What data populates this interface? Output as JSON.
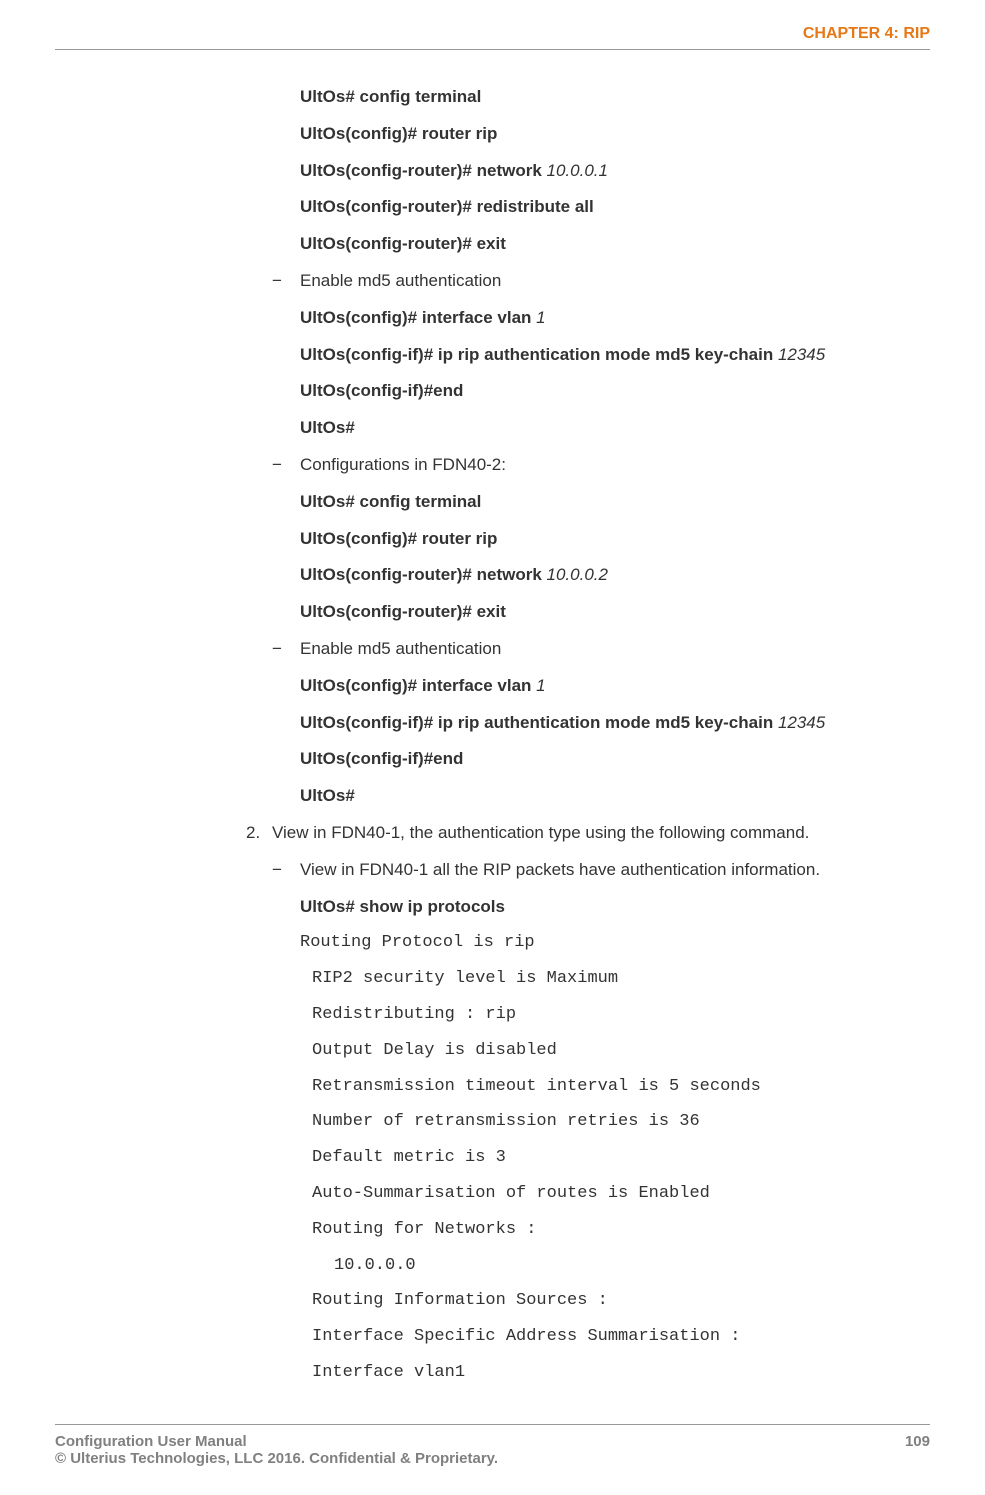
{
  "header": {
    "chapter": "CHAPTER 4: RIP"
  },
  "content": {
    "l1_cmd": "UltOs# config terminal",
    "l2_cmd": "UltOs(config)# router rip",
    "l3_cmd": "UltOs(config-router)# network ",
    "l3_arg": "10.0.0.1",
    "l4_cmd": "UltOs(config-router)# redistribute all",
    "l5_cmd": "UltOs(config-router)# exit",
    "l6_dash": "−",
    "l6_txt": "Enable md5 authentication",
    "l7_cmd": "UltOs(config)# interface vlan ",
    "l7_arg": "1",
    "l8_cmd": "UltOs(config-if)# ip rip authentication mode md5 key-chain ",
    "l8_arg": "12345",
    "l9_cmd": "UltOs(config-if)#end",
    "l10_cmd": "UltOs#",
    "l11_dash": "−",
    "l11_txt": "Configurations in FDN40-2:",
    "l12_cmd": "UltOs# config terminal",
    "l13_cmd": "UltOs(config)# router rip",
    "l14_cmd": "UltOs(config-router)# network ",
    "l14_arg": "10.0.0.2",
    "l15_cmd": "UltOs(config-router)# exit",
    "l16_dash": "−",
    "l16_txt": "Enable md5 authentication",
    "l17_cmd": "UltOs(config)# interface vlan ",
    "l17_arg": "1",
    "l18_cmd": "UltOs(config-if)# ip rip authentication mode md5 key-chain ",
    "l18_arg": "12345",
    "l19_cmd": "UltOs(config-if)#end",
    "l20_cmd": "UltOs#",
    "l21_num": "2.",
    "l21_txt": "View in FDN40-1, the authentication type using the following command.",
    "l22_dash": "−",
    "l22_txt": "View in FDN40-1 all the RIP packets have authentication information.",
    "l23_cmd": "UltOs# show ip protocols",
    "m1": "Routing Protocol is rip",
    "m2": "RIP2 security level is Maximum",
    "m3": "Redistributing : rip",
    "m4": "Output Delay is disabled",
    "m5": "Retransmission timeout interval is 5 seconds",
    "m6": "Number of retransmission retries is 36",
    "m7": "Default metric is 3",
    "m8": "Auto-Summarisation of routes is Enabled",
    "m9": "Routing for Networks :",
    "m10": "10.0.0.0",
    "m11": "Routing Information Sources :",
    "m12": "Interface Specific Address Summarisation :",
    "m13": "Interface vlan1"
  },
  "footer": {
    "line1": "Configuration User Manual",
    "line2": "© Ulterius Technologies, LLC 2016. Confidential & Proprietary.",
    "page": "109"
  }
}
